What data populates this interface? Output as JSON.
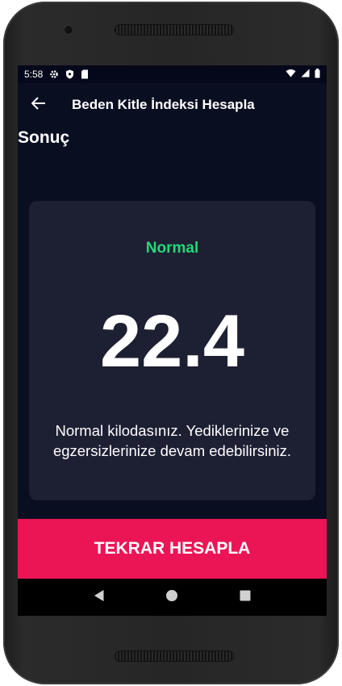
{
  "status_bar": {
    "time": "5:58",
    "icons_left": [
      "gear-icon",
      "shield-icon",
      "sd-card-icon"
    ],
    "icons_right": [
      "wifi-icon",
      "signal-icon",
      "battery-icon"
    ]
  },
  "app_bar": {
    "back_icon": "arrow-back-icon",
    "title": "Beden Kitle İndeksi Hesapla"
  },
  "page": {
    "section_title": "Sonuç"
  },
  "result": {
    "status": "Normal",
    "status_color": "#24d876",
    "bmi": "22.4",
    "message": "Normal kilodasınız. Yediklerinize ve egzersizlerinize devam edebilirsiniz."
  },
  "actions": {
    "recalculate_label": "TEKRAR HESAPLA",
    "button_color": "#eb1555"
  },
  "navigation": {
    "buttons": [
      "back-triangle-icon",
      "home-circle-icon",
      "recents-square-icon"
    ]
  },
  "colors": {
    "background": "#0a0e21",
    "card": "#1d1f33"
  }
}
